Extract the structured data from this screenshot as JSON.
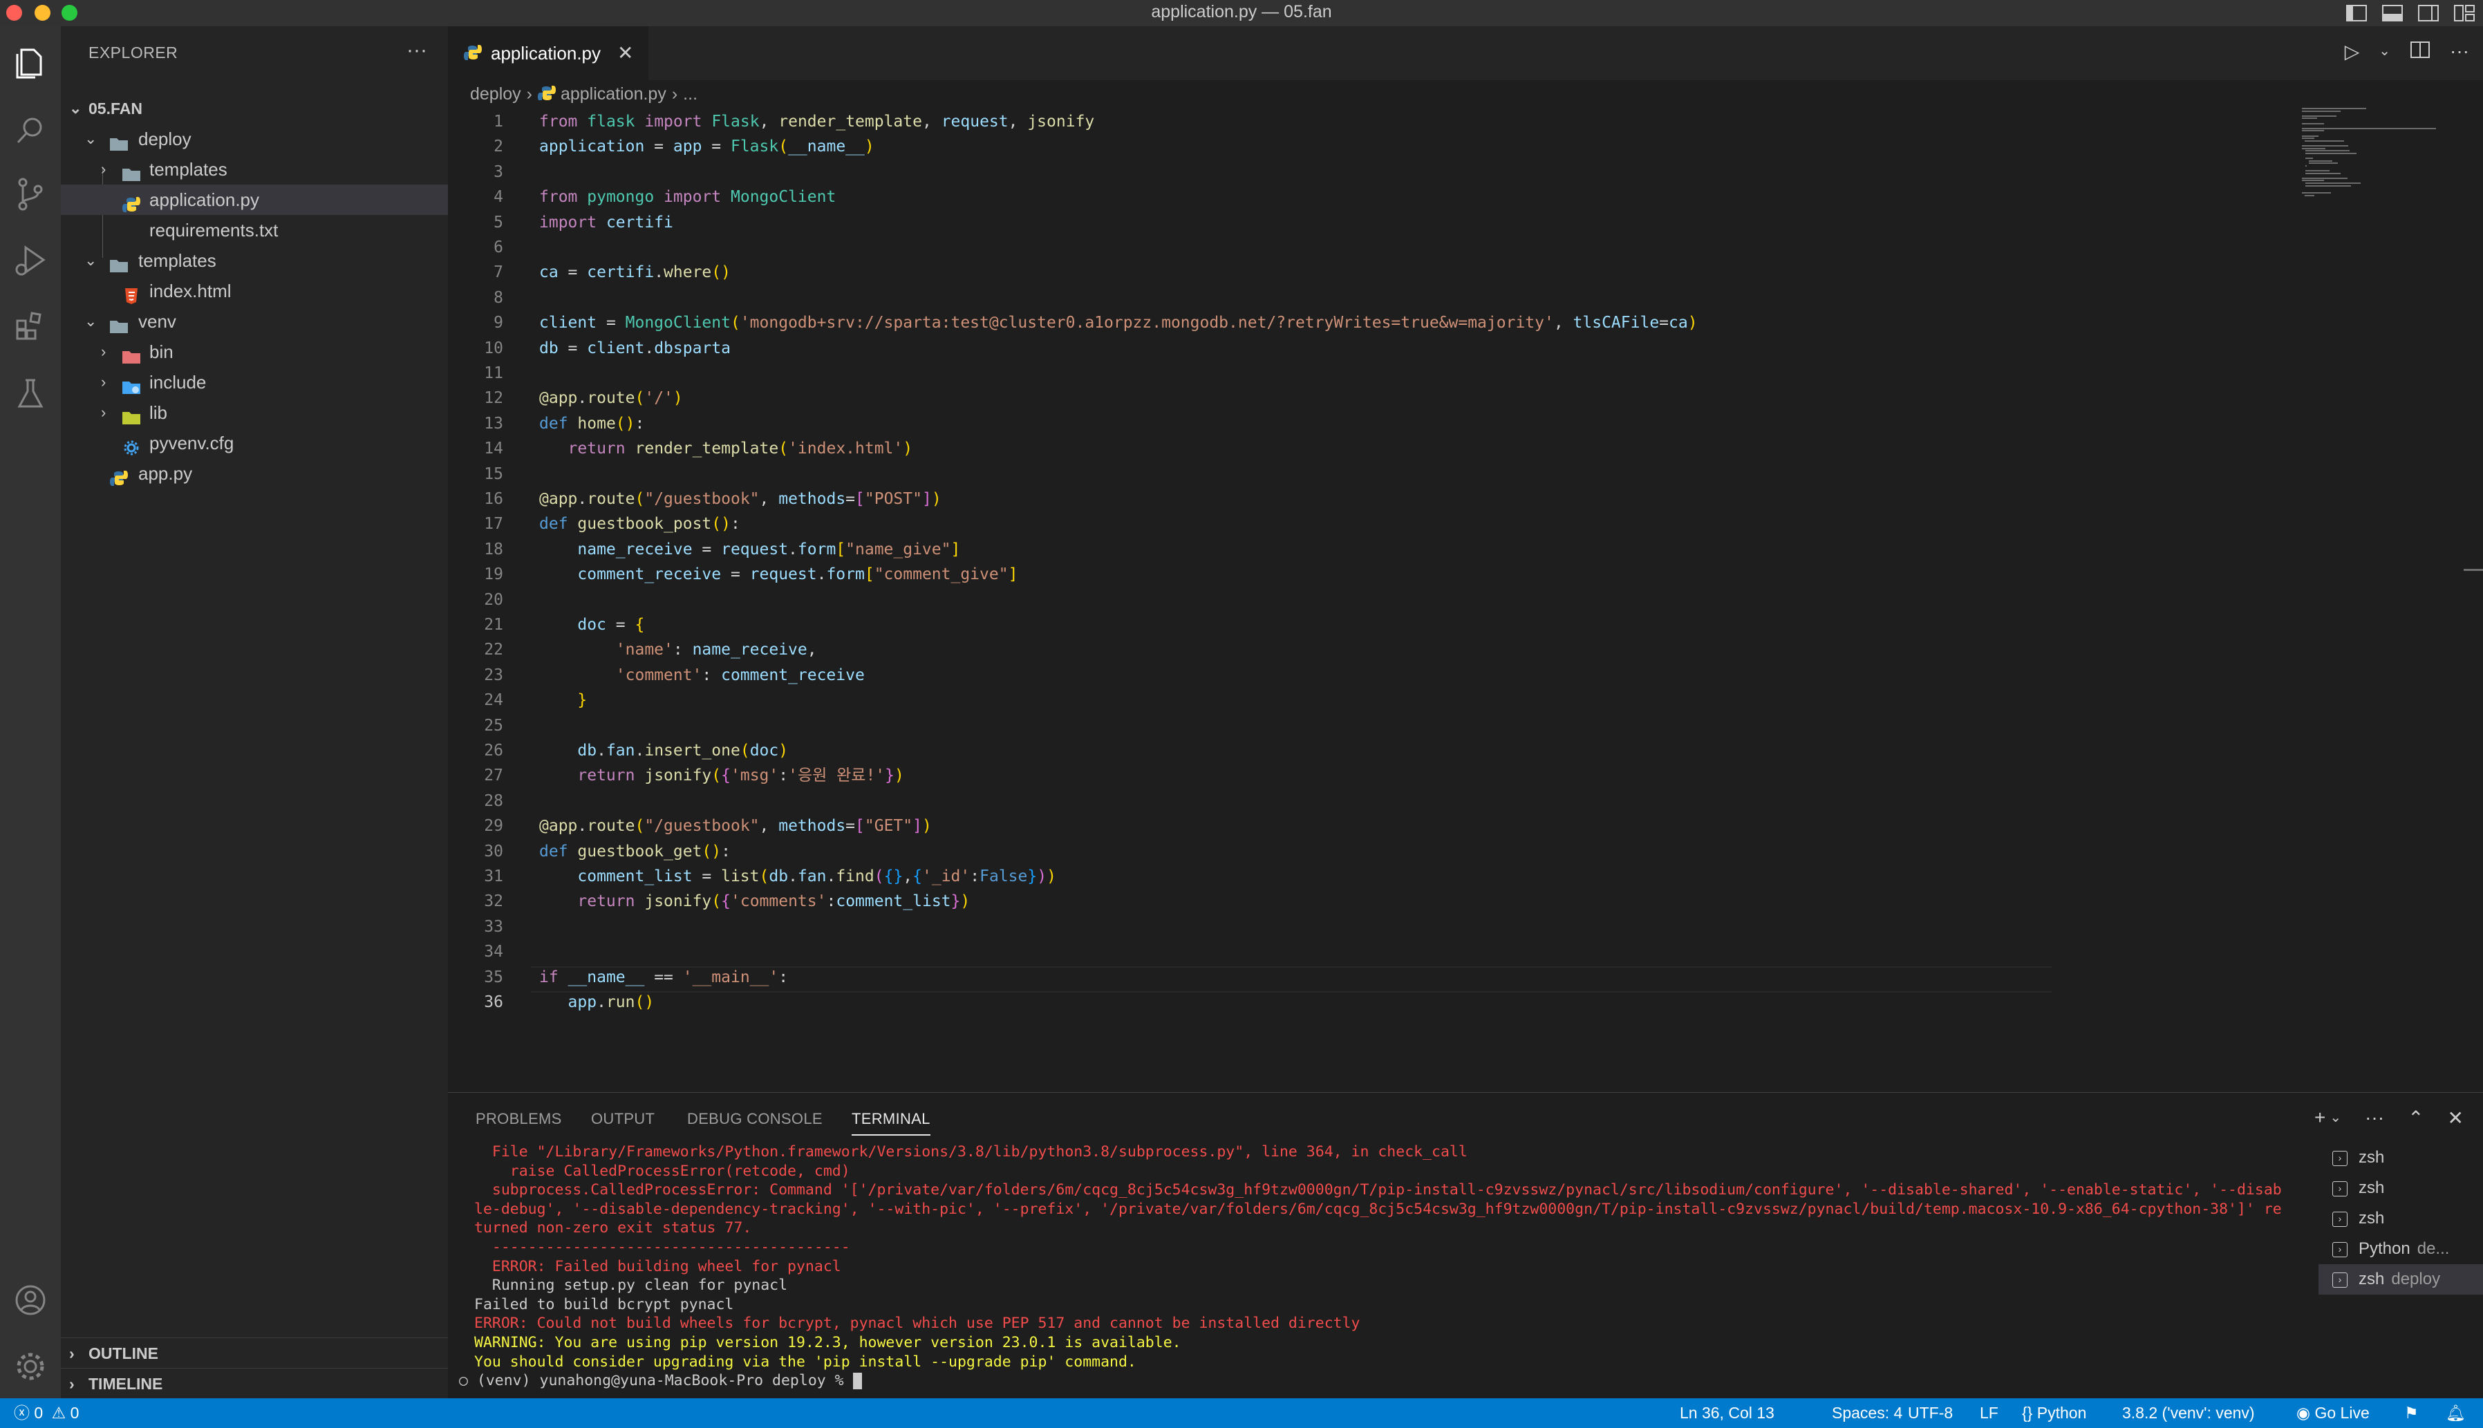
{
  "window": {
    "title": "application.py — 05.fan"
  },
  "sidebar": {
    "header": "EXPLORER",
    "more": "···",
    "root": "05.FAN",
    "tree": [
      {
        "label": "deploy",
        "type": "folder"
      },
      {
        "label": "templates",
        "type": "folder"
      },
      {
        "label": "application.py",
        "type": "python"
      },
      {
        "label": "requirements.txt",
        "type": "text"
      },
      {
        "label": "templates",
        "type": "folder"
      },
      {
        "label": "index.html",
        "type": "html"
      },
      {
        "label": "venv",
        "type": "folder"
      },
      {
        "label": "bin",
        "type": "folder-bin"
      },
      {
        "label": "include",
        "type": "folder-include"
      },
      {
        "label": "lib",
        "type": "folder-lib"
      },
      {
        "label": "pyvenv.cfg",
        "type": "config"
      },
      {
        "label": "app.py",
        "type": "python"
      }
    ],
    "outline": "OUTLINE",
    "timeline": "TIMELINE"
  },
  "editor": {
    "tab": {
      "label": "application.py",
      "close": "✕"
    },
    "breadcrumb": {
      "folder": "deploy",
      "file": "application.py",
      "ellipsis": "..."
    },
    "line_numbers": [
      "1",
      "2",
      "3",
      "4",
      "5",
      "6",
      "7",
      "8",
      "9",
      "10",
      "11",
      "12",
      "13",
      "14",
      "15",
      "16",
      "17",
      "18",
      "19",
      "20",
      "21",
      "22",
      "23",
      "24",
      "25",
      "26",
      "27",
      "28",
      "29",
      "30",
      "31",
      "32",
      "33",
      "34",
      "35",
      "36"
    ],
    "lines": [
      "from flask import Flask, render_template, request, jsonify",
      "application = app = Flask(__name__)",
      "",
      "from pymongo import MongoClient",
      "import certifi",
      "",
      "ca = certifi.where()",
      "",
      "client = MongoClient('mongodb+srv://sparta:test@cluster0.a1orpzz.mongodb.net/?retryWrites=true&w=majority', tlsCAFile=ca)",
      "db = client.dbsparta",
      "",
      "@app.route('/')",
      "def home():",
      "   return render_template('index.html')",
      "",
      "@app.route(\"/guestbook\", methods=[\"POST\"])",
      "def guestbook_post():",
      "    name_receive = request.form[\"name_give\"]",
      "    comment_receive = request.form[\"comment_give\"]",
      "",
      "    doc = {",
      "        'name': name_receive,",
      "        'comment': comment_receive",
      "    }",
      "",
      "    db.fan.insert_one(doc)",
      "    return jsonify({'msg':'응원 완료!'})",
      "",
      "@app.route(\"/guestbook\", methods=[\"GET\"])",
      "def guestbook_get():",
      "    comment_list = list(db.fan.find({},{'_id':False}))",
      "    return jsonify({'comments':comment_list})",
      "",
      "",
      "if __name__ == '__main__':",
      "   app.run()"
    ]
  },
  "panel": {
    "tabs": [
      "PROBLEMS",
      "OUTPUT",
      "DEBUG CONSOLE",
      "TERMINAL"
    ],
    "active_tab": "TERMINAL",
    "terminal_lines": [
      {
        "cls": "e",
        "text": "  File \"/Library/Frameworks/Python.framework/Versions/3.8/lib/python3.8/subprocess.py\", line 364, in check_call"
      },
      {
        "cls": "e",
        "text": "    raise CalledProcessError(retcode, cmd)"
      },
      {
        "cls": "e",
        "text": "  subprocess.CalledProcessError: Command '['/private/var/folders/6m/cqcg_8cj5c54csw3g_hf9tzw0000gn/T/pip-install-c9zvsswz/pynacl/src/libsodium/configure', '--disable-shared', '--enable-static', '--disable-debug', '--disable-dependency-tracking', '--with-pic', '--prefix', '/private/var/folders/6m/cqcg_8cj5c54csw3g_hf9tzw0000gn/T/pip-install-c9zvsswz/pynacl/build/temp.macosx-10.9-x86_64-cpython-38']' returned non-zero exit status 77."
      },
      {
        "cls": "e",
        "text": "  ----------------------------------------"
      },
      {
        "cls": "e",
        "text": "  ERROR: Failed building wheel for pynacl"
      },
      {
        "cls": "n",
        "text": "  Running setup.py clean for pynacl"
      },
      {
        "cls": "n",
        "text": "Failed to build bcrypt pynacl"
      },
      {
        "cls": "e",
        "text": "ERROR: Could not build wheels for bcrypt, pynacl which use PEP 517 and cannot be installed directly"
      },
      {
        "cls": "w",
        "text": "WARNING: You are using pip version 19.2.3, however version 23.0.1 is available."
      },
      {
        "cls": "w",
        "text": "You should consider upgrading via the 'pip install --upgrade pip' command."
      }
    ],
    "prompt": "(venv) yunahong@yuna-MacBook-Pro deploy % ",
    "terminals": [
      {
        "name": "zsh",
        "sub": ""
      },
      {
        "name": "zsh",
        "sub": ""
      },
      {
        "name": "zsh",
        "sub": ""
      },
      {
        "name": "Python",
        "sub": "de..."
      },
      {
        "name": "zsh",
        "sub": "deploy"
      }
    ]
  },
  "statusbar": {
    "errors": "0",
    "warnings": "0",
    "cursor": "Ln 36, Col 13",
    "spaces": "Spaces: 4",
    "encoding": "UTF-8",
    "eol": "LF",
    "language": "Python",
    "interpreter": "3.8.2 ('venv': venv)",
    "golive": "Go Live"
  },
  "colors": {
    "accent": "#007acc",
    "editor_bg": "#1e1e1e",
    "sidebar_bg": "#252526",
    "activity_bg": "#333333",
    "error": "#f14c4c",
    "warning": "#f5f543"
  }
}
